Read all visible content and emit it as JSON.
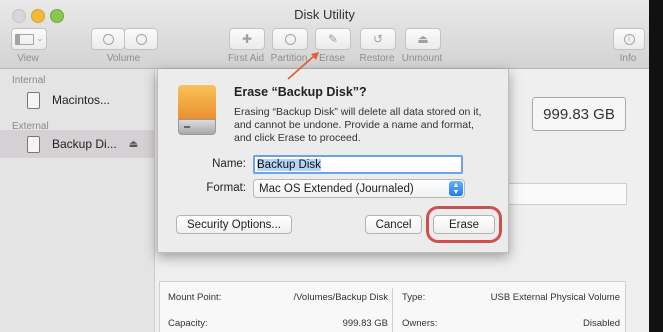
{
  "window": {
    "title": "Disk Utility"
  },
  "toolbar": {
    "view_label": "View",
    "volume_label": "Volume",
    "first_aid_label": "First Aid",
    "partition_label": "Partition",
    "erase_label": "Erase",
    "restore_label": "Restore",
    "unmount_label": "Unmount",
    "info_label": "Info"
  },
  "sidebar": {
    "internal_header": "Internal",
    "external_header": "External",
    "items": [
      {
        "label": "Macintos..."
      },
      {
        "label": "Backup Di..."
      }
    ]
  },
  "main": {
    "capacity": "999.83 GB",
    "info": {
      "mount_point_label": "Mount Point:",
      "mount_point_value": "/Volumes/Backup Disk",
      "capacity_label": "Capacity:",
      "capacity_value": "999.83 GB",
      "type_label": "Type:",
      "type_value": "USB External Physical Volume",
      "owners_label": "Owners:",
      "owners_value": "Disabled"
    }
  },
  "dialog": {
    "title": "Erase “Backup Disk”?",
    "description": "Erasing “Backup Disk” will delete all data stored on it, and cannot be undone. Provide a name and format, and click Erase to proceed.",
    "name_label": "Name:",
    "name_value": "Backup Disk",
    "format_label": "Format:",
    "format_value": "Mac OS Extended (Journaled)",
    "security_button": "Security Options...",
    "cancel_button": "Cancel",
    "erase_button": "Erase"
  },
  "colors": {
    "annotation": "#d0504f",
    "selection": "#6aa4e7",
    "select_arrow": "#1d7cf0"
  },
  "icons": [
    "sidebar-view-icon",
    "volume-add-icon",
    "volume-remove-icon",
    "first-aid-icon",
    "partition-icon",
    "erase-icon",
    "restore-icon",
    "unmount-icon",
    "info-icon",
    "disk-icon",
    "eject-icon",
    "hard-drive-icon"
  ]
}
